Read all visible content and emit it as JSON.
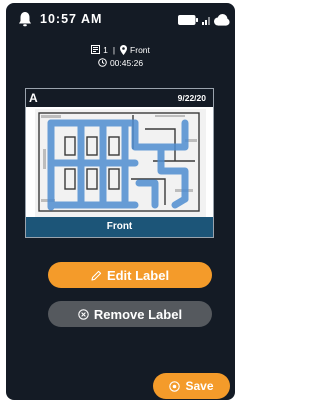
{
  "status_bar": {
    "time": "10:57 AM",
    "icons": [
      "bell-icon",
      "battery-icon",
      "signal-icon",
      "cloud-icon"
    ]
  },
  "session": {
    "map_count": "1",
    "separator": "|",
    "location": "Front",
    "elapsed": "00:45:26"
  },
  "map_card": {
    "letter": "A",
    "date": "9/22/20",
    "label": "Front"
  },
  "actions": {
    "edit_label": "Edit Label",
    "remove_label": "Remove Label",
    "save": "Save"
  },
  "colors": {
    "background": "#141b25",
    "accent": "#f49b2a",
    "secondary_button": "#55595e",
    "card_footer": "#1c5578",
    "map_path": "#4f8ed1"
  }
}
